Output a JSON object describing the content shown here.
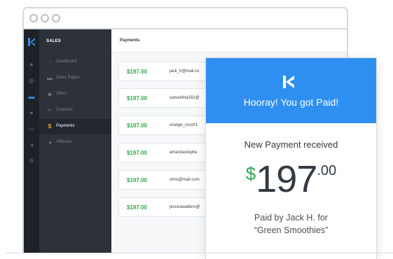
{
  "sidebar": {
    "heading": "SALES",
    "items": [
      {
        "label": "Dashboard",
        "icon": "dashboard-icon"
      },
      {
        "label": "Sales Pages",
        "icon": "sales-pages-icon"
      },
      {
        "label": "Offers",
        "icon": "tag-icon"
      },
      {
        "label": "Coupons",
        "icon": "scissors-icon"
      },
      {
        "label": "Payments",
        "icon": "dollar-icon",
        "active": true
      },
      {
        "label": "Affiliates",
        "icon": "megaphone-icon"
      }
    ]
  },
  "main": {
    "title": "Payments",
    "payments": [
      {
        "amount": "$197.00",
        "email": "jack_h@mail.co"
      },
      {
        "amount": "$197.00",
        "email": "samantha332@"
      },
      {
        "amount": "$197.00",
        "email": "orange_crush1"
      },
      {
        "amount": "$197.00",
        "email": "amandastephe"
      },
      {
        "amount": "$197.00",
        "email": "chris@mail.com"
      },
      {
        "amount": "$197.00",
        "email": "jessicawalters@"
      }
    ]
  },
  "notification": {
    "title": "Hooray! You got Paid!",
    "subtitle": "New Payment received",
    "currency": "$",
    "amount_whole": "197",
    "amount_cents": ".00",
    "paid_by_line1": "Paid by Jack H. for",
    "paid_by_line2": "“Green Smoothies”"
  },
  "colors": {
    "accent_blue": "#2f8ff0",
    "money_green": "#2fa94e",
    "sidebar_dark": "#2d3239"
  }
}
